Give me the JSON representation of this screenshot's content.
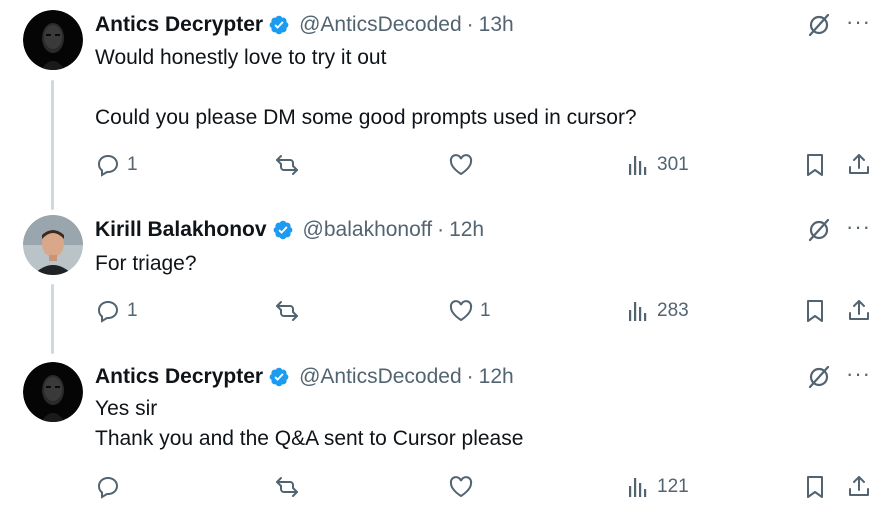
{
  "colors": {
    "text": "#0f1419",
    "secondary": "#536471",
    "verified": "#1d9bf0",
    "thread_line": "#cfd9de"
  },
  "tweets": [
    {
      "author": "Antics Decrypter",
      "handle": "@AnticsDecoded",
      "separator": "·",
      "time": "13h",
      "lines": [
        "Would honestly love to try it out",
        "",
        "Could you please DM some good prompts used in cursor?"
      ],
      "replies": "1",
      "reposts": "",
      "likes": "",
      "views": "301",
      "avatar": "masked-face-avatar"
    },
    {
      "author": "Kirill Balakhonov",
      "handle": "@balakhonoff",
      "separator": "·",
      "time": "12h",
      "lines": [
        "For triage?"
      ],
      "replies": "1",
      "reposts": "",
      "likes": "1",
      "views": "283",
      "avatar": "person-photo-avatar"
    },
    {
      "author": "Antics Decrypter",
      "handle": "@AnticsDecoded",
      "separator": "·",
      "time": "12h",
      "lines": [
        "Yes sir",
        "Thank you and the Q&A sent to Cursor please"
      ],
      "replies": "",
      "reposts": "",
      "likes": "",
      "views": "121",
      "avatar": "masked-face-avatar"
    }
  ],
  "icons": {
    "verified": "verified-badge-icon",
    "grok": "grok-icon",
    "more": "more-icon",
    "reply": "reply-icon",
    "repost": "repost-icon",
    "like": "like-icon",
    "views": "views-icon",
    "bookmark": "bookmark-icon",
    "share": "share-icon"
  },
  "more_glyph": "···"
}
